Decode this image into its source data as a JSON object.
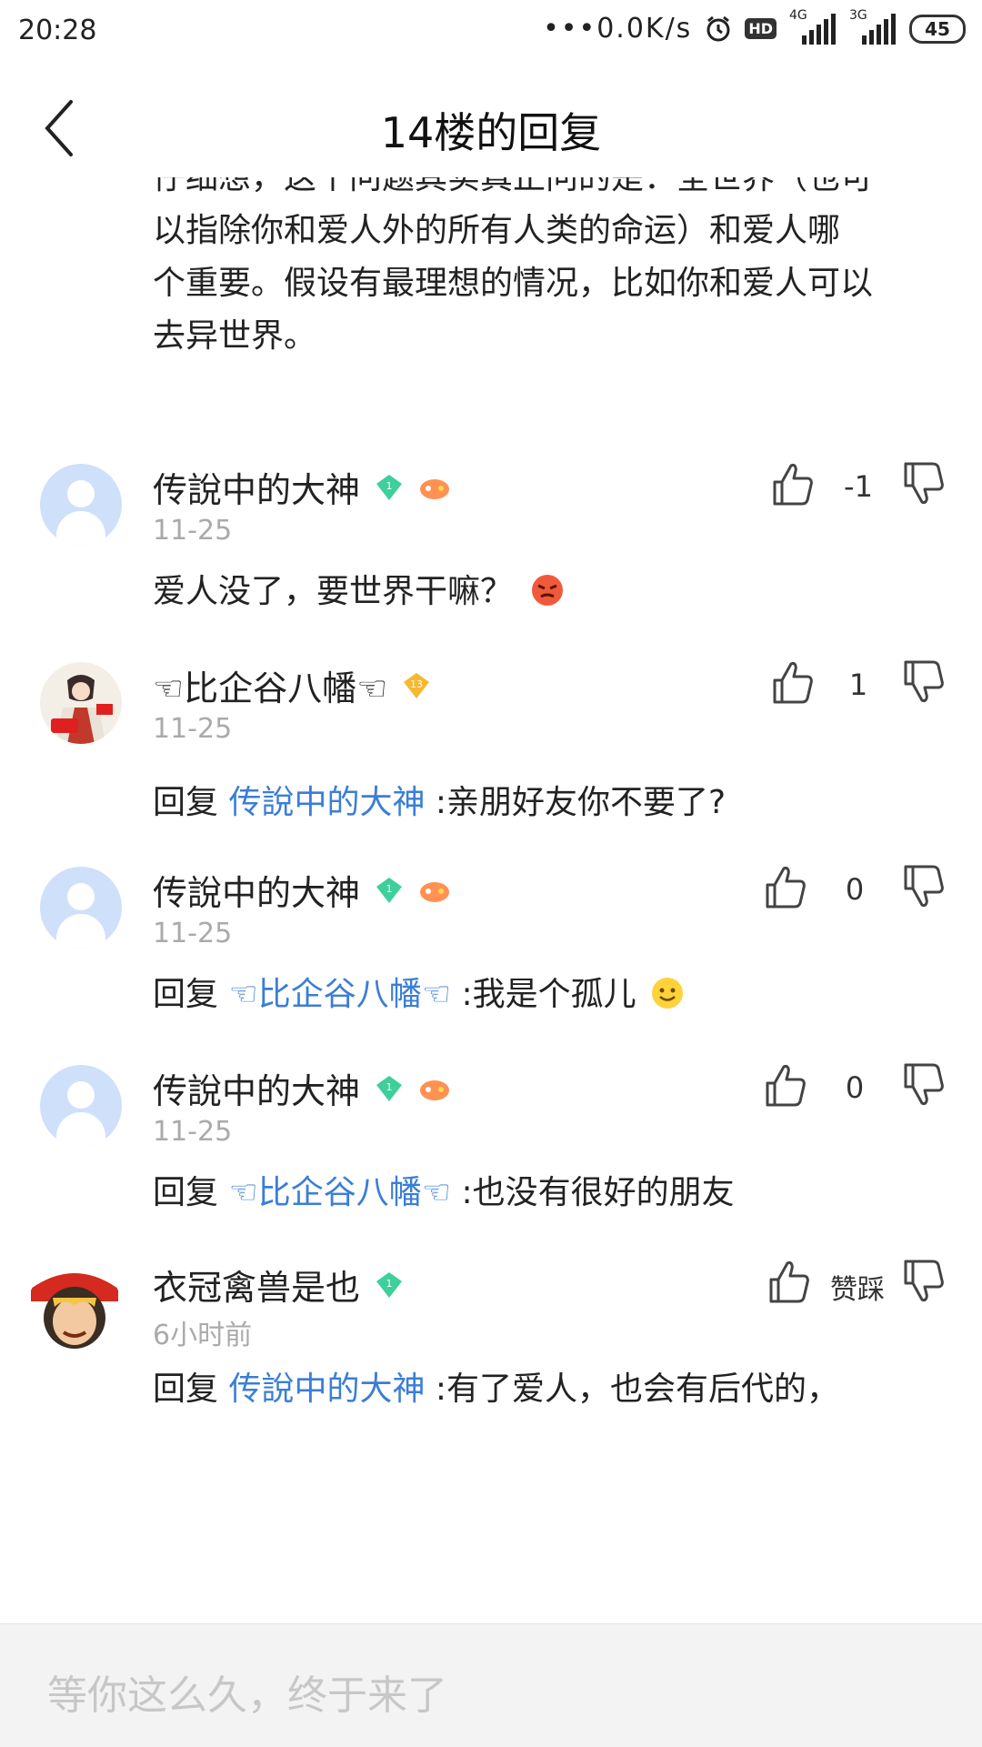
{
  "status_bar": {
    "time": "20:28",
    "net_speed": "•••0.0K/s",
    "hd": "HD",
    "sig1": "4G",
    "sig2": "3G",
    "battery": "45"
  },
  "header": {
    "title": "14楼的回复"
  },
  "original_post": {
    "lines": [
      "仔细想，这个问题其实真正问的是：全世界（也可",
      "以指除你和爱人外的所有人类的命运）和爱人哪",
      "个重要。假设有最理想的情况，比如你和爱人可以",
      "去异世界。"
    ]
  },
  "comments": [
    {
      "username": "传說中的大神",
      "level": "1",
      "time": "11-25",
      "count": "-1",
      "prefix": "",
      "mention": "",
      "text": "爱人没了，要世界干嘛？"
    },
    {
      "username": "☜比企谷八幡☜",
      "level": "13",
      "time": "11-25",
      "count": "1",
      "prefix": "回复 ",
      "mention": "传說中的大神",
      "text": " :亲朋好友你不要了?"
    },
    {
      "username": "传說中的大神",
      "level": "1",
      "time": "11-25",
      "count": "0",
      "prefix": "回复 ",
      "mention": "☜比企谷八幡☜",
      "text": " :我是个孤儿"
    },
    {
      "username": "传說中的大神",
      "level": "1",
      "time": "11-25",
      "count": "0",
      "prefix": "回复 ",
      "mention": "☜比企谷八幡☜",
      "text": " :也没有很好的朋友"
    },
    {
      "username": "衣冠禽兽是也",
      "level": "1",
      "time": "6小时前",
      "count": "赞踩",
      "prefix": "回复 ",
      "mention": "传說中的大神",
      "text": " :有了爱人，也会有后代的，"
    }
  ],
  "input": {
    "placeholder": "等你这么久，终于来了"
  },
  "colors": {
    "link": "#3b7ed6",
    "badge_green": "#3ecf9a",
    "badge_gold": "#f7b731"
  }
}
